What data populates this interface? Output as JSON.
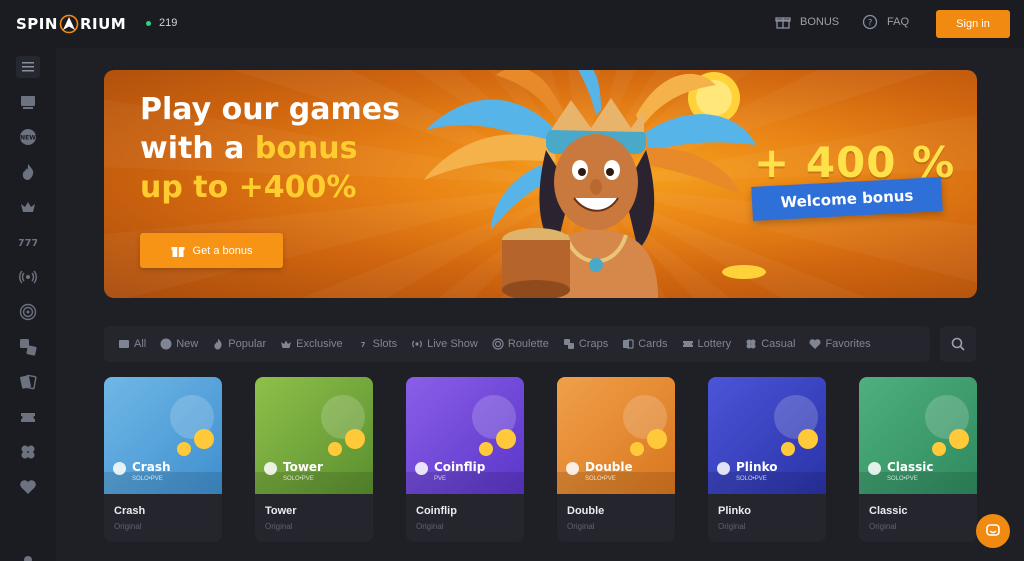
{
  "header": {
    "logo": "SPINARIUM",
    "online_count": "219",
    "bonus_label": "BONUS",
    "faq_label": "FAQ",
    "signin_label": "Sign in"
  },
  "sidebar": {
    "items": [
      "menu-icon",
      "casino-icon",
      "new-icon",
      "fire-icon",
      "crown-icon",
      "slots-icon",
      "live-icon",
      "roulette-icon",
      "dice-icon",
      "cards-icon",
      "ticket-icon",
      "clover-icon",
      "heart-icon",
      "settings-icon"
    ]
  },
  "banner": {
    "line1": "Play our games",
    "line2a": "with a ",
    "line2b": "bonus",
    "line3": "up to +400%",
    "button_label": "Get a bonus",
    "percent": "+ 400 %",
    "ribbon": "Welcome bonus"
  },
  "categories": [
    {
      "label": "All",
      "icon": "all-icon"
    },
    {
      "label": "New",
      "icon": "new-icon"
    },
    {
      "label": "Popular",
      "icon": "fire-icon"
    },
    {
      "label": "Exclusive",
      "icon": "crown-icon"
    },
    {
      "label": "Slots",
      "icon": "slots-icon"
    },
    {
      "label": "Live Show",
      "icon": "live-icon"
    },
    {
      "label": "Roulette",
      "icon": "roulette-icon"
    },
    {
      "label": "Craps",
      "icon": "dice-icon"
    },
    {
      "label": "Cards",
      "icon": "cards-icon"
    },
    {
      "label": "Lottery",
      "icon": "ticket-icon"
    },
    {
      "label": "Casual",
      "icon": "clover-icon"
    },
    {
      "label": "Favorites",
      "icon": "heart-icon"
    }
  ],
  "games": [
    {
      "name": "Crash",
      "sub": "SOLO•PVE",
      "title": "Crash",
      "provider": "Original",
      "color_a": "#3f8fcf",
      "color_b": "#6fb7e6"
    },
    {
      "name": "Tower",
      "sub": "SOLO•PVE",
      "title": "Tower",
      "provider": "Original",
      "color_a": "#5a8f2f",
      "color_b": "#8fc04a"
    },
    {
      "name": "Coinflip",
      "sub": "PVE",
      "title": "Coinflip",
      "provider": "Original",
      "color_a": "#5a36c9",
      "color_b": "#8a5ee8"
    },
    {
      "name": "Double",
      "sub": "SOLO•PVE",
      "title": "Double",
      "provider": "Original",
      "color_a": "#d9761e",
      "color_b": "#f0a04a"
    },
    {
      "name": "Plinko",
      "sub": "SOLO•PVE",
      "title": "Plinko",
      "provider": "Original",
      "color_a": "#2a33a8",
      "color_b": "#4b55d8"
    },
    {
      "name": "Classic",
      "sub": "SOLO•PVE",
      "title": "Classic",
      "provider": "Original",
      "color_a": "#2f8a5e",
      "color_b": "#4fb07e"
    }
  ]
}
